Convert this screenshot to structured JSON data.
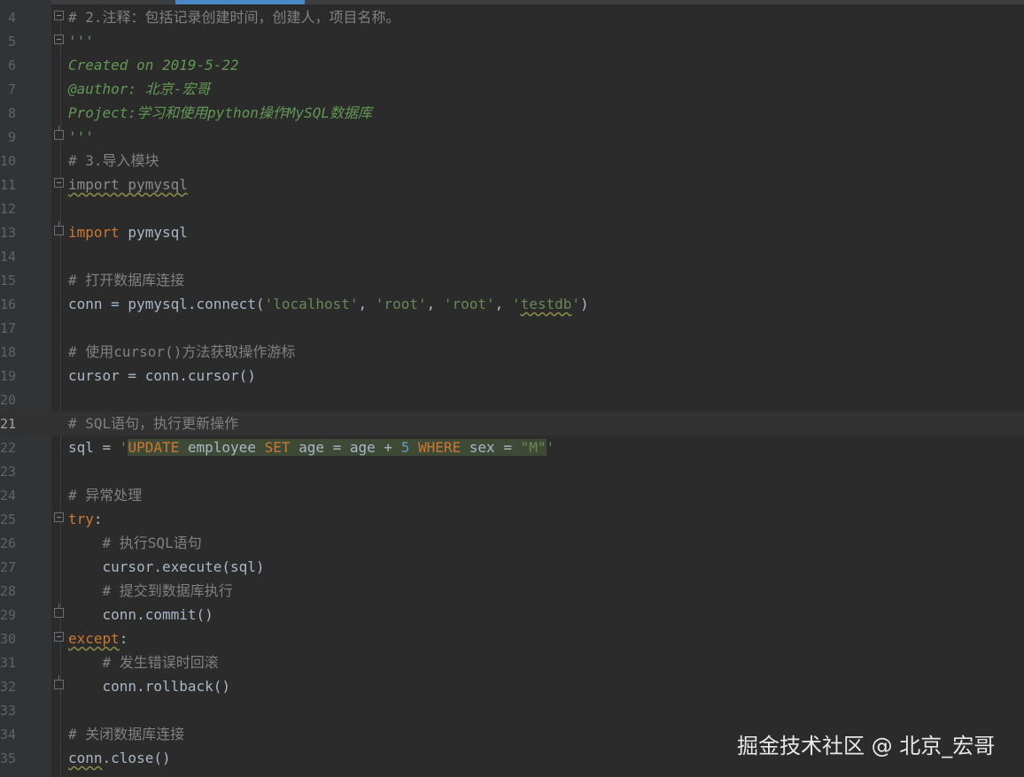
{
  "editor": {
    "lines": [
      {
        "n": "4",
        "tokens": [
          {
            "t": "# 2.注释：包括记录创建时间，创建人，项目名称。",
            "c": "c-cmt"
          }
        ],
        "fold": "open"
      },
      {
        "n": "5",
        "tokens": [
          {
            "t": "'''",
            "c": "c-doc"
          }
        ],
        "fold": "open"
      },
      {
        "n": "6",
        "tokens": [
          {
            "t": "Created on 2019-5-22",
            "c": "c-doc"
          }
        ]
      },
      {
        "n": "7",
        "tokens": [
          {
            "t": "@author: 北京-宏哥",
            "c": "c-doc"
          }
        ]
      },
      {
        "n": "8",
        "tokens": [
          {
            "t": "Project:学习和使用python操作MySQL数据库",
            "c": "c-doc"
          }
        ]
      },
      {
        "n": "9",
        "tokens": [
          {
            "t": "'''",
            "c": "c-doc"
          }
        ],
        "fold": "end"
      },
      {
        "n": "10",
        "tokens": [
          {
            "t": "# 3.导入模块",
            "c": "c-cmt"
          }
        ]
      },
      {
        "n": "11",
        "tokens": [
          {
            "t": "import pymysql",
            "c": "dim wavy"
          }
        ],
        "fold": "open"
      },
      {
        "n": "12",
        "tokens": []
      },
      {
        "n": "13",
        "tokens": [
          {
            "t": "import",
            "c": "c-kw"
          },
          {
            "t": " pymysql"
          }
        ],
        "fold": "end"
      },
      {
        "n": "14",
        "tokens": []
      },
      {
        "n": "15",
        "tokens": [
          {
            "t": "# 打开数据库连接",
            "c": "c-cmt"
          }
        ]
      },
      {
        "n": "16",
        "tokens": [
          {
            "t": "conn = pymysql.connect("
          },
          {
            "t": "'localhost'",
            "c": "c-str"
          },
          {
            "t": ", "
          },
          {
            "t": "'root'",
            "c": "c-str"
          },
          {
            "t": ", "
          },
          {
            "t": "'root'",
            "c": "c-str"
          },
          {
            "t": ", "
          },
          {
            "t": "'",
            "c": "c-str"
          },
          {
            "t": "testdb",
            "c": "c-str wavy"
          },
          {
            "t": "'",
            "c": "c-str"
          },
          {
            "t": ")"
          }
        ]
      },
      {
        "n": "17",
        "tokens": []
      },
      {
        "n": "18",
        "tokens": [
          {
            "t": "# 使用cursor()方法获取操作游标",
            "c": "c-cmt"
          }
        ]
      },
      {
        "n": "19",
        "tokens": [
          {
            "t": "cursor = conn.cursor()"
          }
        ]
      },
      {
        "n": "20",
        "tokens": []
      },
      {
        "n": "21",
        "tokens": [
          {
            "t": "# SQL语句，执行更新操作",
            "c": "c-cmt"
          }
        ],
        "current": true
      },
      {
        "n": "22",
        "tokens": [
          {
            "t": "sql = "
          },
          {
            "t": "'",
            "c": "c-str"
          },
          {
            "t": "UPDATE",
            "c": "c-sql c-sqlkw"
          },
          {
            "t": " employee ",
            "c": "c-sql"
          },
          {
            "t": "SET",
            "c": "c-sql c-sqlkw"
          },
          {
            "t": " age = age + ",
            "c": "c-sql"
          },
          {
            "t": "5",
            "c": "c-sql c-num"
          },
          {
            "t": " ",
            "c": "c-sql"
          },
          {
            "t": "WHERE",
            "c": "c-sql c-sqlkw"
          },
          {
            "t": " sex = ",
            "c": "c-sql"
          },
          {
            "t": "\"M\"",
            "c": "c-sql c-str"
          },
          {
            "t": "'",
            "c": "c-str"
          }
        ]
      },
      {
        "n": "23",
        "tokens": []
      },
      {
        "n": "24",
        "tokens": [
          {
            "t": "# 异常处理",
            "c": "c-cmt"
          }
        ]
      },
      {
        "n": "25",
        "tokens": [
          {
            "t": "try",
            "c": "c-kw"
          },
          {
            "t": ":"
          }
        ],
        "fold": "open"
      },
      {
        "n": "26",
        "tokens": [
          {
            "t": "    # 执行SQL语句",
            "c": "c-cmt"
          }
        ]
      },
      {
        "n": "27",
        "tokens": [
          {
            "t": "    cursor.execute(sql)"
          }
        ]
      },
      {
        "n": "28",
        "tokens": [
          {
            "t": "    # 提交到数据库执行",
            "c": "c-cmt"
          }
        ]
      },
      {
        "n": "29",
        "tokens": [
          {
            "t": "    conn.commit()"
          }
        ],
        "fold": "end"
      },
      {
        "n": "30",
        "tokens": [
          {
            "t": "except",
            "c": "c-kw wavy"
          },
          {
            "t": ":"
          }
        ],
        "fold": "open"
      },
      {
        "n": "31",
        "tokens": [
          {
            "t": "    # 发生错误时回滚",
            "c": "c-cmt"
          }
        ]
      },
      {
        "n": "32",
        "tokens": [
          {
            "t": "    conn.rollback()"
          }
        ],
        "fold": "end"
      },
      {
        "n": "33",
        "tokens": []
      },
      {
        "n": "34",
        "tokens": [
          {
            "t": "# 关闭数据库连接",
            "c": "c-cmt"
          }
        ]
      },
      {
        "n": "35",
        "tokens": [
          {
            "t": "conn",
            "c": "wavy"
          },
          {
            "t": ".close()"
          }
        ]
      }
    ]
  },
  "watermark": "掘金技术社区 @ 北京_宏哥"
}
